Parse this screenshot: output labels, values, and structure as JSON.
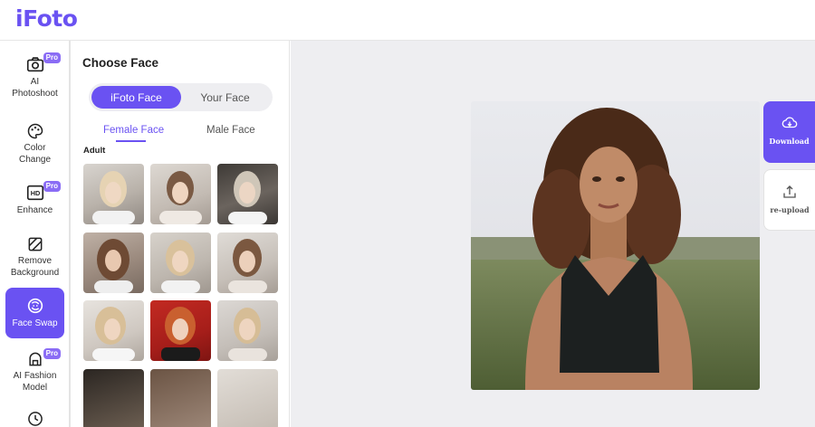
{
  "app": {
    "logo": "iFoto"
  },
  "sidebar": {
    "items": [
      {
        "label": "AI\nPhotoshoot",
        "icon": "camera-icon",
        "pro": true,
        "active": false
      },
      {
        "label": "Color\nChange",
        "icon": "palette-icon",
        "pro": false,
        "active": false
      },
      {
        "label": "Enhance",
        "icon": "hd-icon",
        "pro": true,
        "active": false
      },
      {
        "label": "Remove\nBackground",
        "icon": "eraser-icon",
        "pro": false,
        "active": false
      },
      {
        "label": "Face Swap",
        "icon": "face-swap-icon",
        "pro": false,
        "active": true
      },
      {
        "label": "AI Fashion\nModel",
        "icon": "hanger-icon",
        "pro": true,
        "active": false
      },
      {
        "label": "",
        "icon": "history-icon",
        "pro": false,
        "active": false
      }
    ],
    "pro_badge": "Pro"
  },
  "panel": {
    "title": "Choose Face",
    "source_tabs": [
      "iFoto Face",
      "Your Face"
    ],
    "gender_tabs": [
      "Female Face",
      "Male Face"
    ],
    "section_label": "Adult"
  },
  "actions": {
    "download": "Download",
    "reupload": "re-upload"
  },
  "colors": {
    "accent": "#6a52f2",
    "canvas_bg": "#eeeef1",
    "pro_badge": "#8a6cf5"
  }
}
